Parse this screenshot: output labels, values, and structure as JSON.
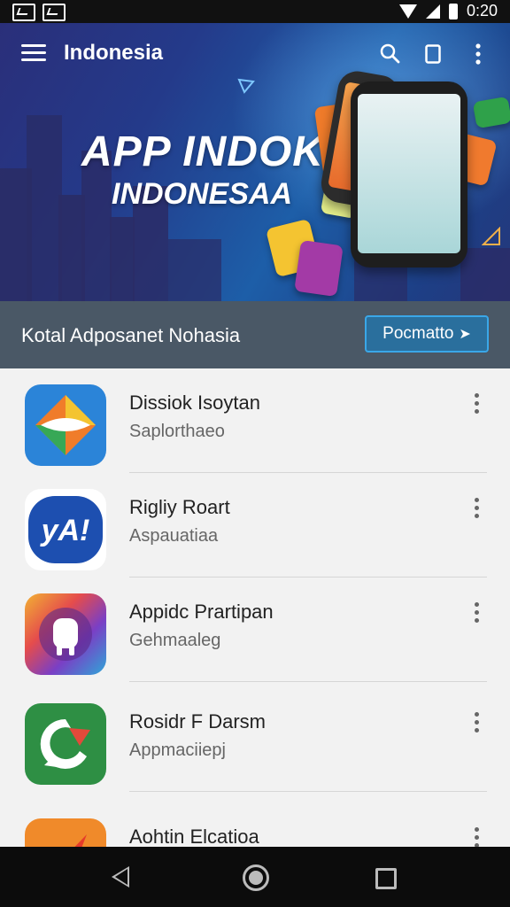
{
  "status_bar": {
    "time": "0:20"
  },
  "app_bar": {
    "title": "Indonesia"
  },
  "hero": {
    "title": "APP INDOK",
    "subtitle": "INDONESAA"
  },
  "banner": {
    "text": "Kotal Adposanet Nohasia",
    "button_label": "Pocmatto"
  },
  "apps": [
    {
      "name": "Dissiok Isoytan",
      "category": "Saplorthaeo"
    },
    {
      "name": "Rigliy Roart",
      "category": "Aspauatiaa"
    },
    {
      "name": "Appidc Prartipan",
      "category": "Gehmaaleg"
    },
    {
      "name": "Rosidr F Darsm",
      "category": "Appmaciiepj"
    },
    {
      "name": "Aohtin Elcatioa",
      "category": ""
    }
  ],
  "colors": {
    "banner_button_border": "#3aa7e8",
    "hero_gradient": "#2a2f7a",
    "banner_bg": "#4a5866"
  },
  "icons": [
    "menu-icon",
    "search-icon",
    "bookmark-icon",
    "more-vert-icon",
    "back-icon",
    "home-icon",
    "recents-icon"
  ]
}
